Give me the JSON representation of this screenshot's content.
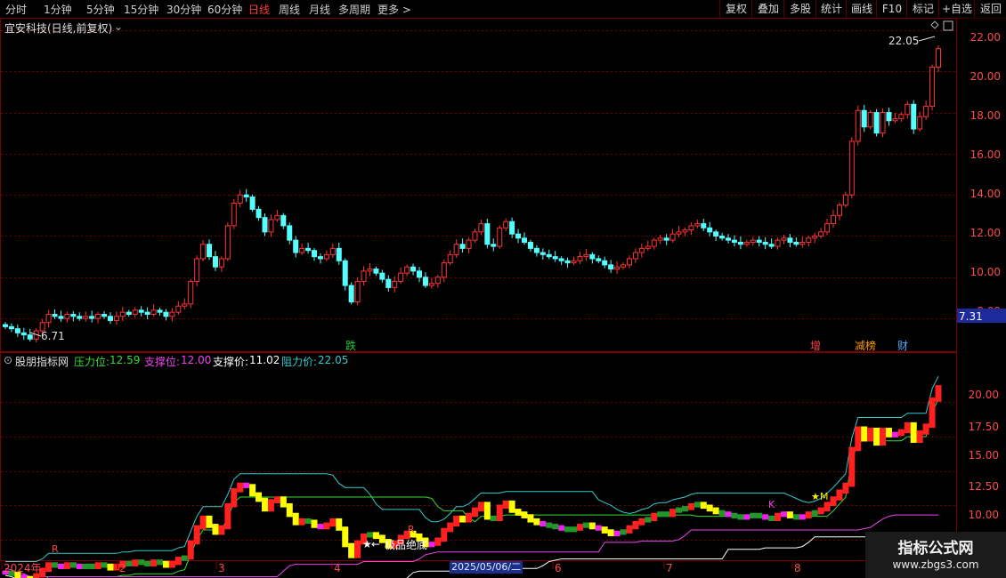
{
  "toolbar": {
    "periods": [
      "分时",
      "1分钟",
      "5分钟",
      "15分钟",
      "30分钟",
      "60分钟",
      "日线",
      "周线",
      "月线",
      "多周期",
      "更多 >"
    ],
    "active_period": "日线",
    "right_buttons": [
      "复权",
      "叠加",
      "多股",
      "统计",
      "画线",
      "F10",
      "标记",
      "+自选",
      "返回"
    ]
  },
  "main_panel": {
    "title": "宜安科技(日线,前复权)",
    "price_axis": [
      "22.00",
      "20.00",
      "18.00",
      "16.00",
      "14.00",
      "12.00",
      "10.00",
      "8.00"
    ],
    "current_price_box": "7.31",
    "high_label": "22.05",
    "low_label": "6.71",
    "event_markers": [
      {
        "label": "跌",
        "color": "#22cc33"
      },
      {
        "label": "增",
        "color": "#ff4444"
      },
      {
        "label": "减榜",
        "color": "#ff9900"
      },
      {
        "label": "财",
        "color": "#4ea8ff"
      }
    ]
  },
  "indicator_panel": {
    "name": "股朋指标网",
    "pressure_label": "压力位:",
    "pressure_value": "12.59",
    "support_label": "支撑位:",
    "support_value": "12.00",
    "support_price_label": "支撑价:",
    "support_price_value": "11.02",
    "resist_label": "阻力价:",
    "resist_value": "22.05",
    "axis": [
      "20.00",
      "17.50",
      "15.00",
      "12.50",
      "10.00"
    ],
    "annotation": "极品绝底",
    "markers": [
      "R",
      "R",
      "K",
      "M"
    ]
  },
  "date_axis": {
    "labels": [
      "2024年",
      "2",
      "3",
      "4",
      "6",
      "7",
      "8"
    ],
    "cursor_date": "2025/05/06/二"
  },
  "watermark": {
    "line1": "指标公式网",
    "line2": "www.zbgs3.com"
  },
  "colors": {
    "up": "#ff3333",
    "down": "#54ffff",
    "grid": "#7a0000",
    "pressure": "#33dd33",
    "support": "#ee44ee",
    "support_price": "#ffffff",
    "resist": "#33cccc"
  },
  "chart_data": {
    "type": "candlestick",
    "price_range": [
      7.4,
      22.6
    ],
    "indicator_range": [
      8.5,
      23.4
    ],
    "closes": [
      7.6,
      7.5,
      7.3,
      7.2,
      7.0,
      7.4,
      7.8,
      8.2,
      8.1,
      8.0,
      8.2,
      8.1,
      8.0,
      8.1,
      8.0,
      8.2,
      8.1,
      7.9,
      8.1,
      8.3,
      8.2,
      8.4,
      8.3,
      8.2,
      8.4,
      8.3,
      8.1,
      8.3,
      8.6,
      8.7,
      9.8,
      10.9,
      11.6,
      11.0,
      10.5,
      10.9,
      12.5,
      13.6,
      14.0,
      13.9,
      13.3,
      12.9,
      12.2,
      12.8,
      13.0,
      12.5,
      11.8,
      11.2,
      11.4,
      11.3,
      11.0,
      10.9,
      11.1,
      11.4,
      10.8,
      9.6,
      8.8,
      9.8,
      10.3,
      10.4,
      10.2,
      9.9,
      9.5,
      9.8,
      10.2,
      10.5,
      10.3,
      10.0,
      9.6,
      9.7,
      10.0,
      10.7,
      11.1,
      11.6,
      11.4,
      11.8,
      12.2,
      12.6,
      11.6,
      11.5,
      12.4,
      12.7,
      12.1,
      11.9,
      11.7,
      11.4,
      11.2,
      11.1,
      11.0,
      10.9,
      10.8,
      10.7,
      10.8,
      11.0,
      11.1,
      10.9,
      10.8,
      10.6,
      10.4,
      10.5,
      10.6,
      10.9,
      11.2,
      11.4,
      11.5,
      11.8,
      11.9,
      11.8,
      12.1,
      12.2,
      12.3,
      12.5,
      12.6,
      12.4,
      12.2,
      12.0,
      11.9,
      11.8,
      11.7,
      11.6,
      11.7,
      11.8,
      11.7,
      11.6,
      11.5,
      11.8,
      11.9,
      11.7,
      11.6,
      11.7,
      11.9,
      12.0,
      12.2,
      12.6,
      13.0,
      13.5,
      14.0,
      16.6,
      18.1,
      17.3,
      18.0,
      17.0,
      18.0,
      17.6,
      17.7,
      17.9,
      18.4,
      17.2,
      17.8,
      18.3,
      20.2,
      21.1
    ]
  }
}
